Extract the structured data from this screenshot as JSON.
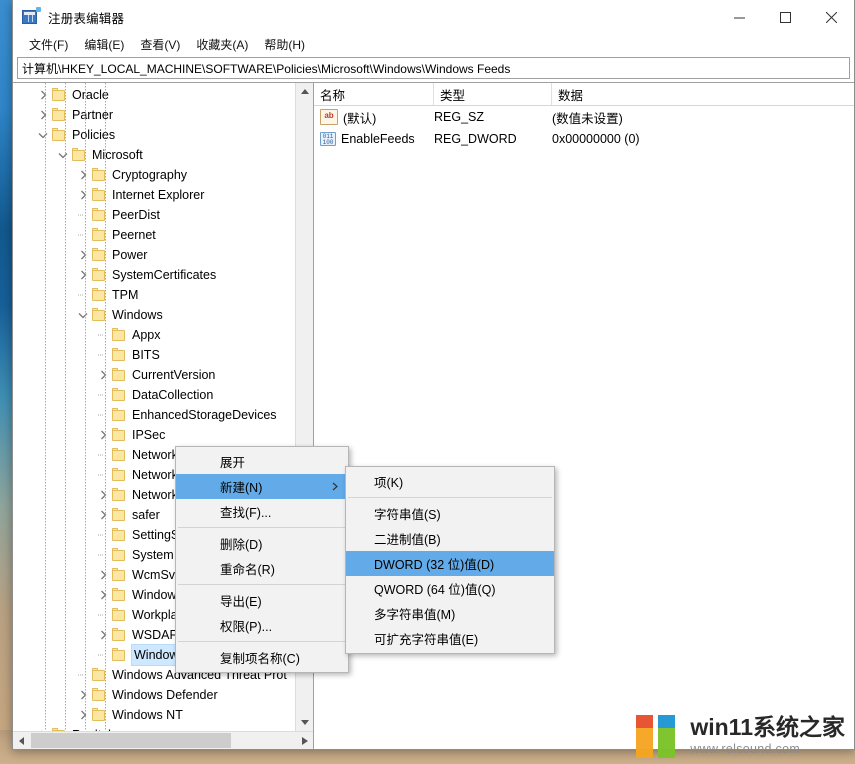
{
  "window": {
    "title": "注册表编辑器",
    "icon": "registry-editor-icon",
    "controls": {
      "minimize": "最小化",
      "maximize": "最大化",
      "close": "关闭"
    }
  },
  "menubar": {
    "items": [
      {
        "label": "文件(F)"
      },
      {
        "label": "编辑(E)"
      },
      {
        "label": "查看(V)"
      },
      {
        "label": "收藏夹(A)"
      },
      {
        "label": "帮助(H)"
      }
    ]
  },
  "address": {
    "value": "计算机\\HKEY_LOCAL_MACHINE\\SOFTWARE\\Policies\\Microsoft\\Windows\\Windows Feeds"
  },
  "tree": {
    "items": [
      {
        "label": "Oracle",
        "depth": 1,
        "chevron": "right",
        "selected": false
      },
      {
        "label": "Partner",
        "depth": 1,
        "chevron": "right",
        "selected": false
      },
      {
        "label": "Policies",
        "depth": 1,
        "chevron": "down",
        "selected": false
      },
      {
        "label": "Microsoft",
        "depth": 2,
        "chevron": "down",
        "selected": false
      },
      {
        "label": "Cryptography",
        "depth": 3,
        "chevron": "right",
        "selected": false
      },
      {
        "label": "Internet Explorer",
        "depth": 3,
        "chevron": "right",
        "selected": false
      },
      {
        "label": "PeerDist",
        "depth": 3,
        "chevron": "none",
        "selected": false
      },
      {
        "label": "Peernet",
        "depth": 3,
        "chevron": "none",
        "selected": false
      },
      {
        "label": "Power",
        "depth": 3,
        "chevron": "right",
        "selected": false
      },
      {
        "label": "SystemCertificates",
        "depth": 3,
        "chevron": "right",
        "selected": false
      },
      {
        "label": "TPM",
        "depth": 3,
        "chevron": "none",
        "selected": false
      },
      {
        "label": "Windows",
        "depth": 3,
        "chevron": "down",
        "selected": false
      },
      {
        "label": "Appx",
        "depth": 4,
        "chevron": "none",
        "selected": false
      },
      {
        "label": "BITS",
        "depth": 4,
        "chevron": "none",
        "selected": false
      },
      {
        "label": "CurrentVersion",
        "depth": 4,
        "chevron": "right",
        "selected": false
      },
      {
        "label": "DataCollection",
        "depth": 4,
        "chevron": "none",
        "selected": false
      },
      {
        "label": "EnhancedStorageDevices",
        "depth": 4,
        "chevron": "none",
        "selected": false
      },
      {
        "label": "IPSec",
        "depth": 4,
        "chevron": "right",
        "selected": false
      },
      {
        "label": "Network Connections",
        "depth": 4,
        "chevron": "none",
        "selected": false
      },
      {
        "label": "Network Connectivity",
        "depth": 4,
        "chevron": "none",
        "selected": false
      },
      {
        "label": "NetworkProvider",
        "depth": 4,
        "chevron": "right",
        "selected": false
      },
      {
        "label": "safer",
        "depth": 4,
        "chevron": "right",
        "selected": false
      },
      {
        "label": "SettingSync",
        "depth": 4,
        "chevron": "none",
        "selected": false
      },
      {
        "label": "System",
        "depth": 4,
        "chevron": "none",
        "selected": false
      },
      {
        "label": "WcmSvc",
        "depth": 4,
        "chevron": "right",
        "selected": false
      },
      {
        "label": "WindowsUpdate",
        "depth": 4,
        "chevron": "right",
        "selected": false
      },
      {
        "label": "Workplace Join",
        "depth": 4,
        "chevron": "none",
        "selected": false
      },
      {
        "label": "WSDAPI",
        "depth": 4,
        "chevron": "right",
        "selected": false
      },
      {
        "label": "Windows Feeds",
        "depth": 4,
        "chevron": "none",
        "selected": true
      },
      {
        "label": "Windows Advanced Threat Prot",
        "depth": 3,
        "chevron": "none",
        "selected": false
      },
      {
        "label": "Windows Defender",
        "depth": 3,
        "chevron": "right",
        "selected": false
      },
      {
        "label": "Windows NT",
        "depth": 3,
        "chevron": "right",
        "selected": false
      },
      {
        "label": "Realtek",
        "depth": 1,
        "chevron": "right",
        "selected": false
      }
    ]
  },
  "values": {
    "columns": [
      {
        "label": "名称"
      },
      {
        "label": "类型"
      },
      {
        "label": "数据"
      }
    ],
    "rows": [
      {
        "icon": "string-value-icon",
        "name": "(默认)",
        "type": "REG_SZ",
        "data": "(数值未设置)"
      },
      {
        "icon": "dword-value-icon",
        "name": "EnableFeeds",
        "type": "REG_DWORD",
        "data": "0x00000000 (0)"
      }
    ]
  },
  "context_menu": {
    "items": [
      {
        "label": "展开",
        "highlight": false,
        "submenu": false,
        "separator_after": false
      },
      {
        "label": "新建(N)",
        "highlight": true,
        "submenu": true,
        "separator_after": false
      },
      {
        "label": "查找(F)...",
        "highlight": false,
        "submenu": false,
        "separator_after": true
      },
      {
        "label": "删除(D)",
        "highlight": false,
        "submenu": false,
        "separator_after": false
      },
      {
        "label": "重命名(R)",
        "highlight": false,
        "submenu": false,
        "separator_after": true
      },
      {
        "label": "导出(E)",
        "highlight": false,
        "submenu": false,
        "separator_after": false
      },
      {
        "label": "权限(P)...",
        "highlight": false,
        "submenu": false,
        "separator_after": true
      },
      {
        "label": "复制项名称(C)",
        "highlight": false,
        "submenu": false,
        "separator_after": false
      }
    ]
  },
  "submenu": {
    "items": [
      {
        "label": "项(K)",
        "highlight": false,
        "separator_after": true
      },
      {
        "label": "字符串值(S)",
        "highlight": false,
        "separator_after": false
      },
      {
        "label": "二进制值(B)",
        "highlight": false,
        "separator_after": false
      },
      {
        "label": "DWORD (32 位)值(D)",
        "highlight": true,
        "separator_after": false
      },
      {
        "label": "QWORD (64 位)值(Q)",
        "highlight": false,
        "separator_after": false
      },
      {
        "label": "多字符串值(M)",
        "highlight": false,
        "separator_after": false
      },
      {
        "label": "可扩充字符串值(E)",
        "highlight": false,
        "separator_after": false
      }
    ]
  },
  "watermark": {
    "title": "win11系统之家",
    "url": "www.relsound.com",
    "colors": {
      "left_top": "#e8502e",
      "left_stem": "#f5a623",
      "right_top": "#2196d4",
      "right_stem": "#7cc42a"
    }
  },
  "theme": {
    "selection_blue": "#62abe8",
    "tree_selection": "#cde8ff",
    "folder_fill": "#fbe6a2",
    "folder_border": "#e3bd5c"
  }
}
